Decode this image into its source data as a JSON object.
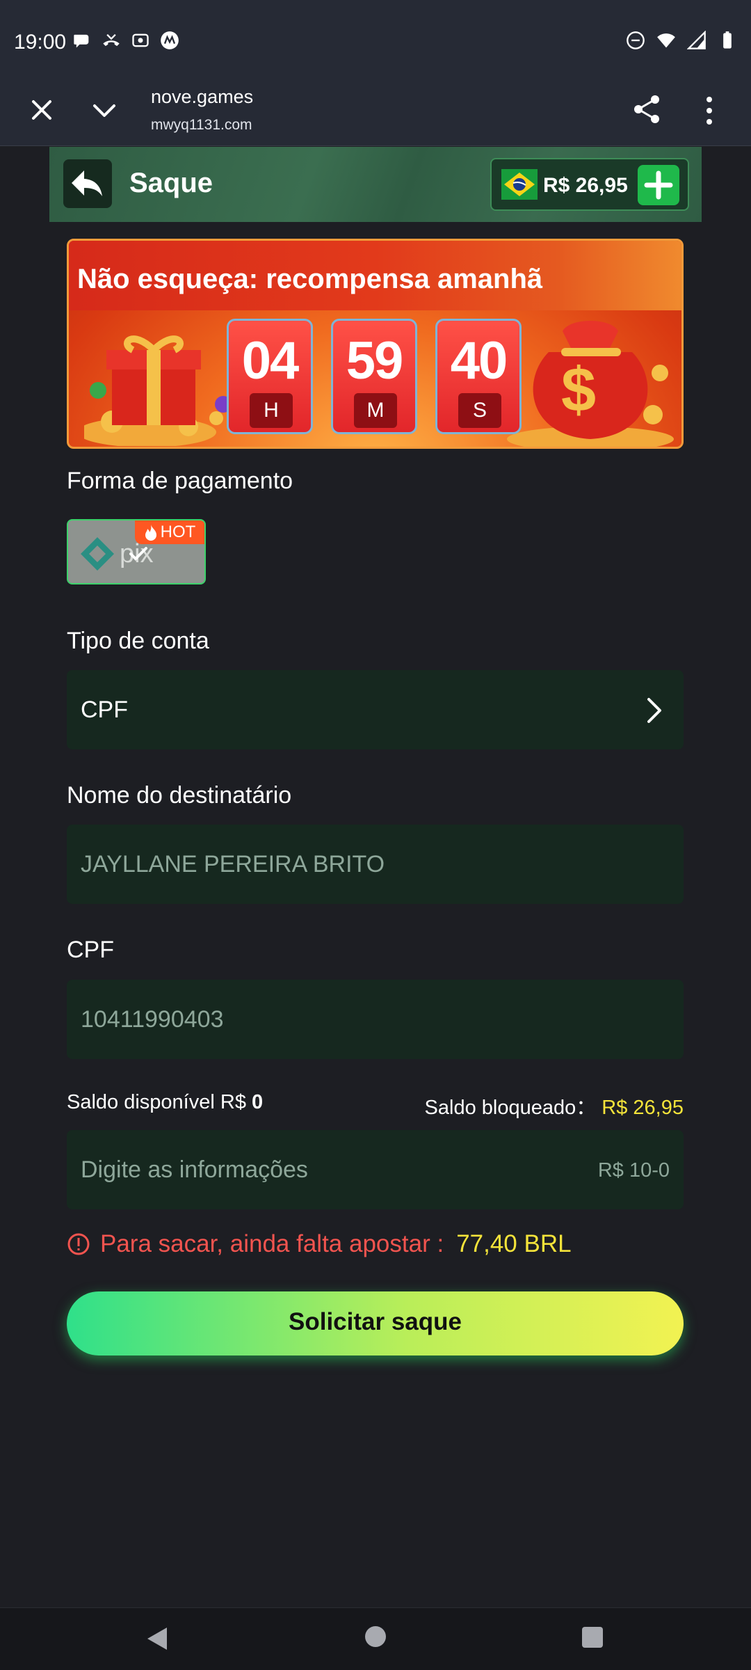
{
  "status_bar": {
    "time": "19:00",
    "left_icons": [
      "chat-bubble-icon",
      "missed-call-icon",
      "cast-icon",
      "motorola-icon"
    ],
    "right_icons": [
      "do-not-disturb-icon",
      "wifi-icon",
      "signal-icon",
      "battery-icon"
    ]
  },
  "browser": {
    "domain": "nove.games",
    "url": "mwyq1131.com"
  },
  "header": {
    "title": "Saque",
    "balance": "R$ 26,95"
  },
  "banner": {
    "title": "Não esqueça: recompensa amanhã",
    "timer": [
      {
        "value": "04",
        "unit": "H"
      },
      {
        "value": "59",
        "unit": "M"
      },
      {
        "value": "40",
        "unit": "S"
      }
    ]
  },
  "payment": {
    "label": "Forma de pagamento",
    "method_badge": "HOT",
    "method_icon": "pix-logo-icon"
  },
  "account_type": {
    "label": "Tipo de conta",
    "value": "CPF"
  },
  "recipient": {
    "label": "Nome do destinatário",
    "value": "JAYLLANE PEREIRA BRITO"
  },
  "cpf": {
    "label": "CPF",
    "value": "10411990403"
  },
  "balances": {
    "available_label": "Saldo disponível R$",
    "available_value": "0",
    "blocked_label": "Saldo bloqueado：",
    "blocked_value": "R$ 26,95"
  },
  "amount": {
    "placeholder": "Digite as informações",
    "range": "R$ 10-0"
  },
  "warning": {
    "text": "Para sacar, ainda falta apostar :",
    "amount": "77,40 BRL"
  },
  "submit": {
    "label": "Solicitar saque"
  },
  "colors": {
    "background": "#1d1e23",
    "field": "#16281f",
    "accent_green": "#1fb94b",
    "warning_red": "#f2544f",
    "highlight_yellow": "#f4e33a"
  }
}
